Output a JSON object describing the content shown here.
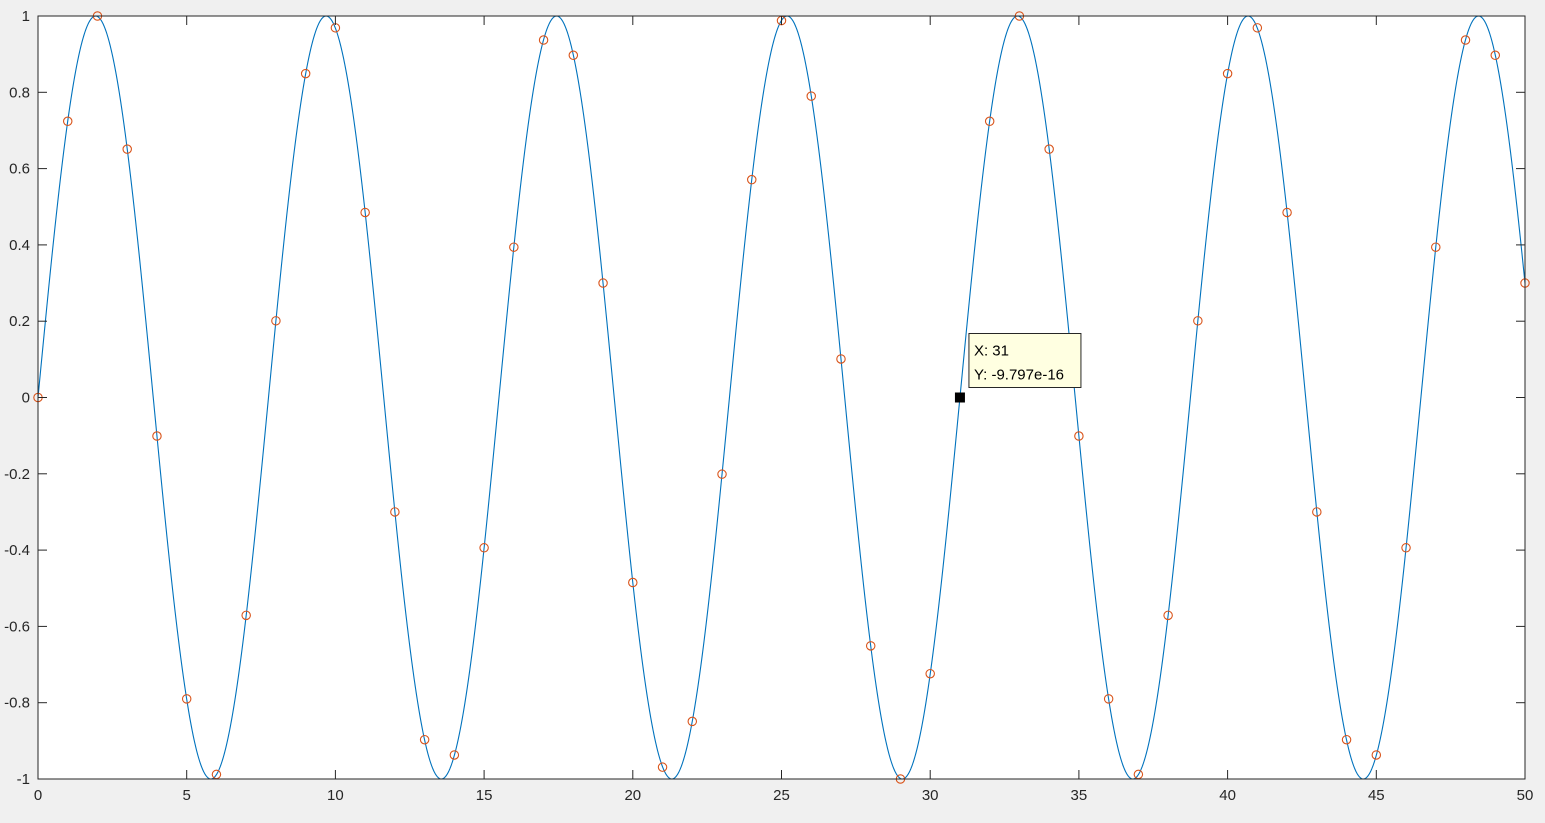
{
  "chart_data": {
    "type": "line",
    "title": "",
    "xlabel": "",
    "ylabel": "",
    "xlim": [
      0,
      50
    ],
    "ylim": [
      -1,
      1
    ],
    "grid": false,
    "legend": "none",
    "x_ticks": [
      "0",
      "5",
      "10",
      "15",
      "20",
      "25",
      "30",
      "35",
      "40",
      "45",
      "50"
    ],
    "y_ticks": [
      "1",
      "0.8",
      "0.6",
      "0.4",
      "0.2",
      "0",
      "-0.2",
      "-0.4",
      "-0.6",
      "-0.8",
      "-1"
    ],
    "series": [
      {
        "kind": "line",
        "color": "#0072bd",
        "function": "sin(2*pi*x/7.75)",
        "period": 7.75,
        "x_range": [
          0,
          50
        ]
      },
      {
        "kind": "scatter",
        "marker": "circle",
        "color": "#d95319",
        "x": [
          0,
          1,
          2,
          3,
          4,
          5,
          6,
          7,
          8,
          9,
          10,
          11,
          12,
          13,
          14,
          15,
          16,
          17,
          18,
          19,
          20,
          21,
          22,
          23,
          24,
          25,
          26,
          27,
          28,
          29,
          30,
          31,
          32,
          33,
          34,
          35,
          36,
          37,
          38,
          39,
          40,
          41,
          42,
          43,
          44,
          45,
          46,
          47,
          48,
          49,
          50
        ],
        "y": [
          0,
          0.724,
          1.0,
          0.651,
          -0.101,
          -0.79,
          -0.988,
          -0.571,
          0.201,
          0.849,
          0.969,
          0.485,
          -0.3,
          -0.897,
          -0.937,
          -0.394,
          0.394,
          0.937,
          0.897,
          0.3,
          -0.485,
          -0.969,
          -0.849,
          -0.201,
          0.571,
          0.988,
          0.79,
          0.101,
          -0.651,
          -1.0,
          -0.724,
          0,
          0.724,
          1.0,
          0.651,
          -0.101,
          -0.79,
          -0.988,
          -0.571,
          0.201,
          0.849,
          0.969,
          0.485,
          -0.3,
          -0.897,
          -0.937,
          -0.394,
          0.394,
          0.937,
          0.897,
          0.3
        ]
      }
    ],
    "datatip": {
      "x": 31,
      "y": 0,
      "x_label": "X: 31",
      "y_label": "Y: -9.797e-16"
    }
  }
}
